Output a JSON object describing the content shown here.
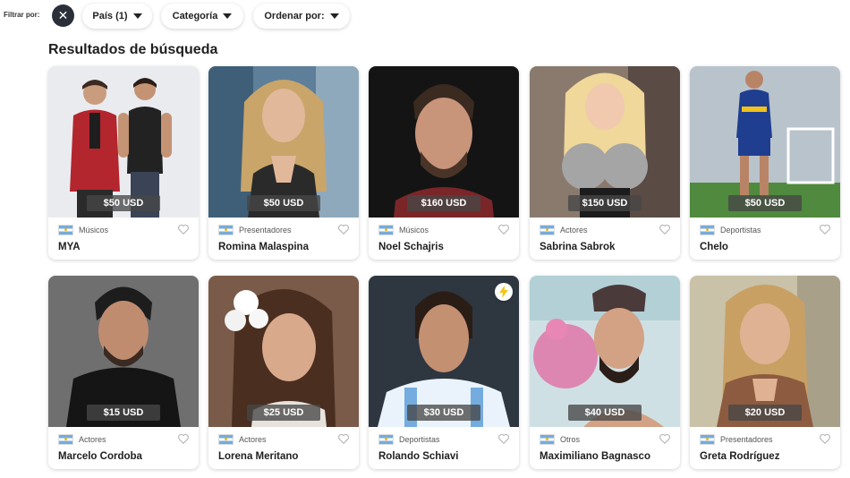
{
  "filters": {
    "label": "Filtrar por:",
    "clear_icon": "close-icon",
    "clear_glyph": "✕",
    "country_label": "País (1)",
    "category_label": "Categoría",
    "sort_label": "Ordenar por:"
  },
  "results": {
    "title": "Resultados de búsqueda",
    "cards": [
      {
        "name": "MYA",
        "category": "Músicos",
        "price": "$50 USD"
      },
      {
        "name": "Romina Malaspina",
        "category": "Presentadores",
        "price": "$50 USD"
      },
      {
        "name": "Noel Schajris",
        "category": "Músicos",
        "price": "$160 USD"
      },
      {
        "name": "Sabrina Sabrok",
        "category": "Actores",
        "price": "$150 USD"
      },
      {
        "name": "Chelo",
        "category": "Deportistas",
        "price": "$50 USD"
      },
      {
        "name": "Marcelo Cordoba",
        "category": "Actores",
        "price": "$15 USD"
      },
      {
        "name": "Lorena Meritano",
        "category": "Actores",
        "price": "$25 USD"
      },
      {
        "name": "Rolando Schiavi",
        "category": "Deportistas",
        "price": "$30 USD",
        "badge": "lightning-icon"
      },
      {
        "name": "Maximiliano Bagnasco",
        "category": "Otros",
        "price": "$40 USD"
      },
      {
        "name": "Greta Rodríguez",
        "category": "Presentadores",
        "price": "$20 USD"
      }
    ]
  },
  "colors": {
    "accent_dark": "#2b2f3a",
    "price_badge": "#464646",
    "bolt_badge": "#f5c518",
    "flag_blue": "#74acdf"
  }
}
